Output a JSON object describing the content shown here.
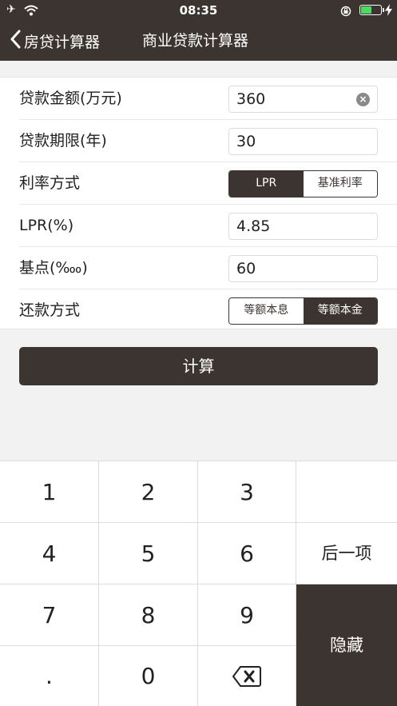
{
  "status_bar": {
    "time": "08:35",
    "icons": [
      "airplane-icon",
      "wifi-icon",
      "rotation-lock-icon",
      "battery-icon",
      "charging-bolt-icon"
    ],
    "battery_level": 0.55,
    "battery_color": "#4cd964"
  },
  "nav": {
    "back_label": "房贷计算器",
    "title": "商业贷款计算器"
  },
  "form": {
    "loan_amount": {
      "label": "贷款金额(万元)",
      "value": "360"
    },
    "loan_term": {
      "label": "贷款期限(年)",
      "value": "30"
    },
    "rate_mode": {
      "label": "利率方式",
      "options": [
        "LPR",
        "基准利率"
      ],
      "selected": "LPR"
    },
    "lpr": {
      "label": "LPR(%)",
      "value": "4.85"
    },
    "basis_points": {
      "label": "基点(‱)",
      "value": "60"
    },
    "repayment": {
      "label": "还款方式",
      "options": [
        "等额本息",
        "等额本金"
      ],
      "selected": "等额本金"
    }
  },
  "calculate_label": "计算",
  "keypad": {
    "digits": [
      "1",
      "2",
      "3",
      "4",
      "5",
      "6",
      "7",
      "8",
      "9",
      ".",
      "0"
    ],
    "next_label": "后一项",
    "hide_label": "隐藏"
  },
  "colors": {
    "primary": "#3b3431",
    "background": "#f2f2f2"
  }
}
